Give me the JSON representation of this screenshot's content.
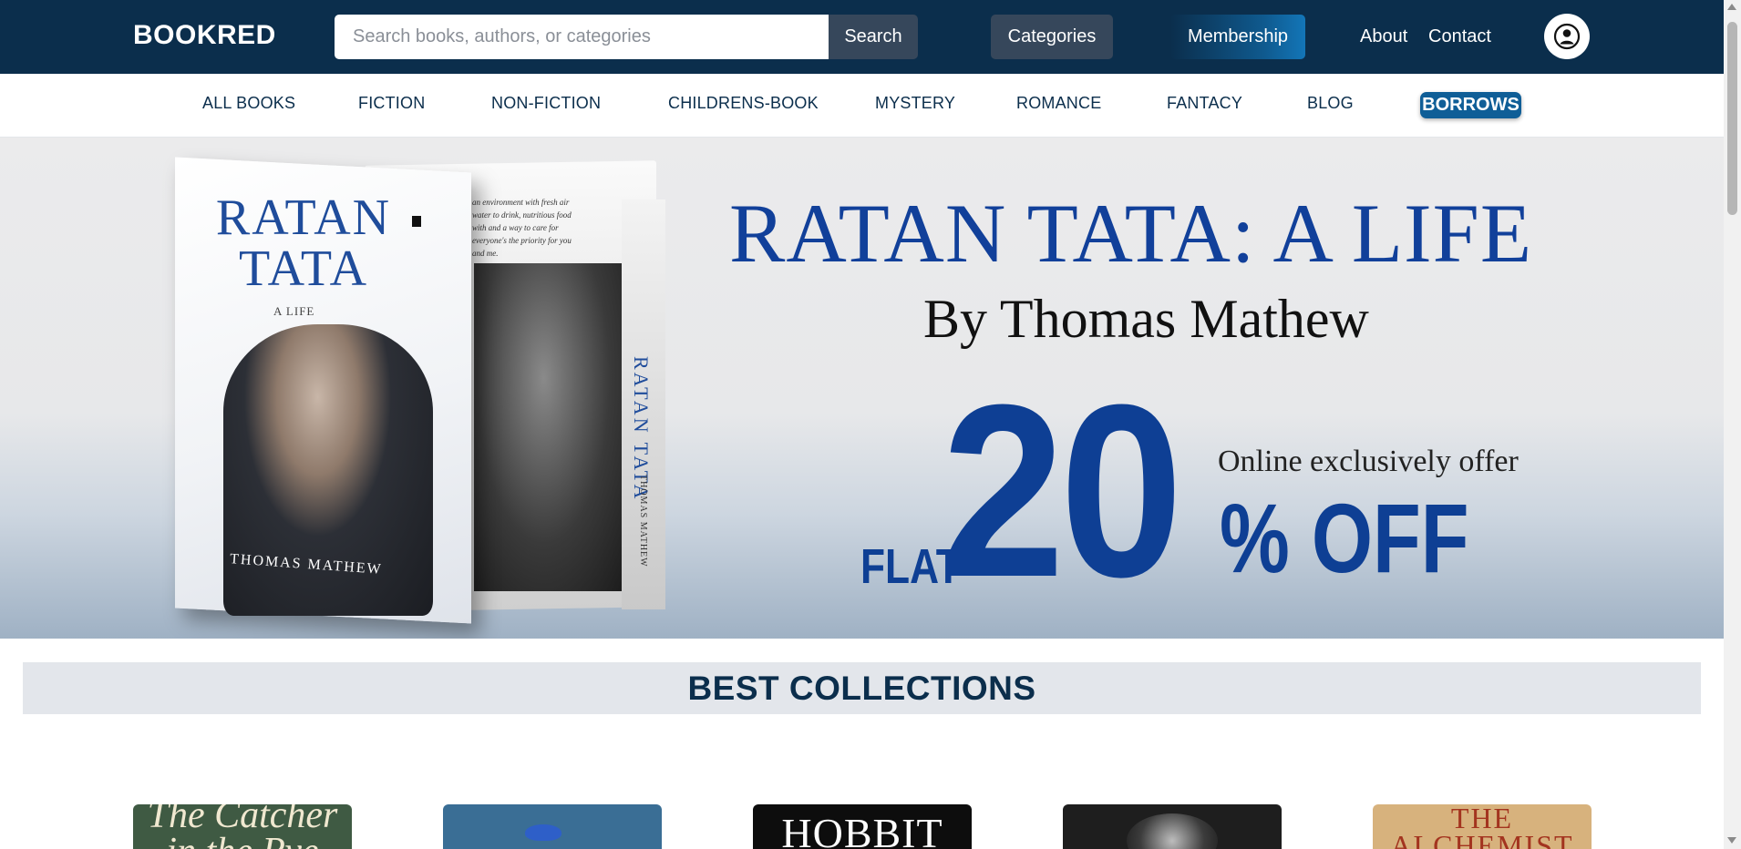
{
  "header": {
    "logo": "BOOKRED",
    "search_placeholder": "Search books, authors, or categories",
    "search_button": "Search",
    "categories_button": "Categories",
    "membership_button": "Membership",
    "about_link": "About",
    "contact_link": "Contact",
    "avatar_icon": "user-circle-icon"
  },
  "category_nav": {
    "items": [
      "ALL BOOKS",
      "FICTION",
      "NON-FICTION",
      "CHILDRENS-BOOK",
      "MYSTERY",
      "ROMANCE",
      "FANTACY",
      "BLOG"
    ],
    "highlight": "BORROWS"
  },
  "hero": {
    "title": "RATAN TATA: A LIFE",
    "byline": "By Thomas Mathew",
    "flat": "FLAT",
    "discount_number": "20",
    "online_text": "Online exclusively offer",
    "off_text": "% OFF",
    "cover_title_line1": "RATAN",
    "cover_title_line2": "TATA",
    "cover_subtitle": "A LIFE",
    "cover_author": "THOMAS MATHEW",
    "spine_title": "RATAN TATA",
    "spine_author": "THOMAS MATHEW",
    "back_blurb": "an environment with fresh air water to drink, nutritious food with and a way to care for everyone's the priority for you and me."
  },
  "collections": {
    "title": "BEST COLLECTIONS",
    "books": [
      {
        "text": "The Catcher in the Rye",
        "color": "#3f5a43"
      },
      {
        "text": "",
        "color": "#3a6e95"
      },
      {
        "text": "HOBBIT",
        "color": "#0d0d0d"
      },
      {
        "text": "",
        "color": "#1e1e1e"
      },
      {
        "text": "THE ALCHEMIST",
        "color": "#d7b27d"
      }
    ]
  },
  "colors": {
    "header_bg": "#0b2e4c",
    "accent": "#0f5e97",
    "hero_blue": "#11409a"
  }
}
